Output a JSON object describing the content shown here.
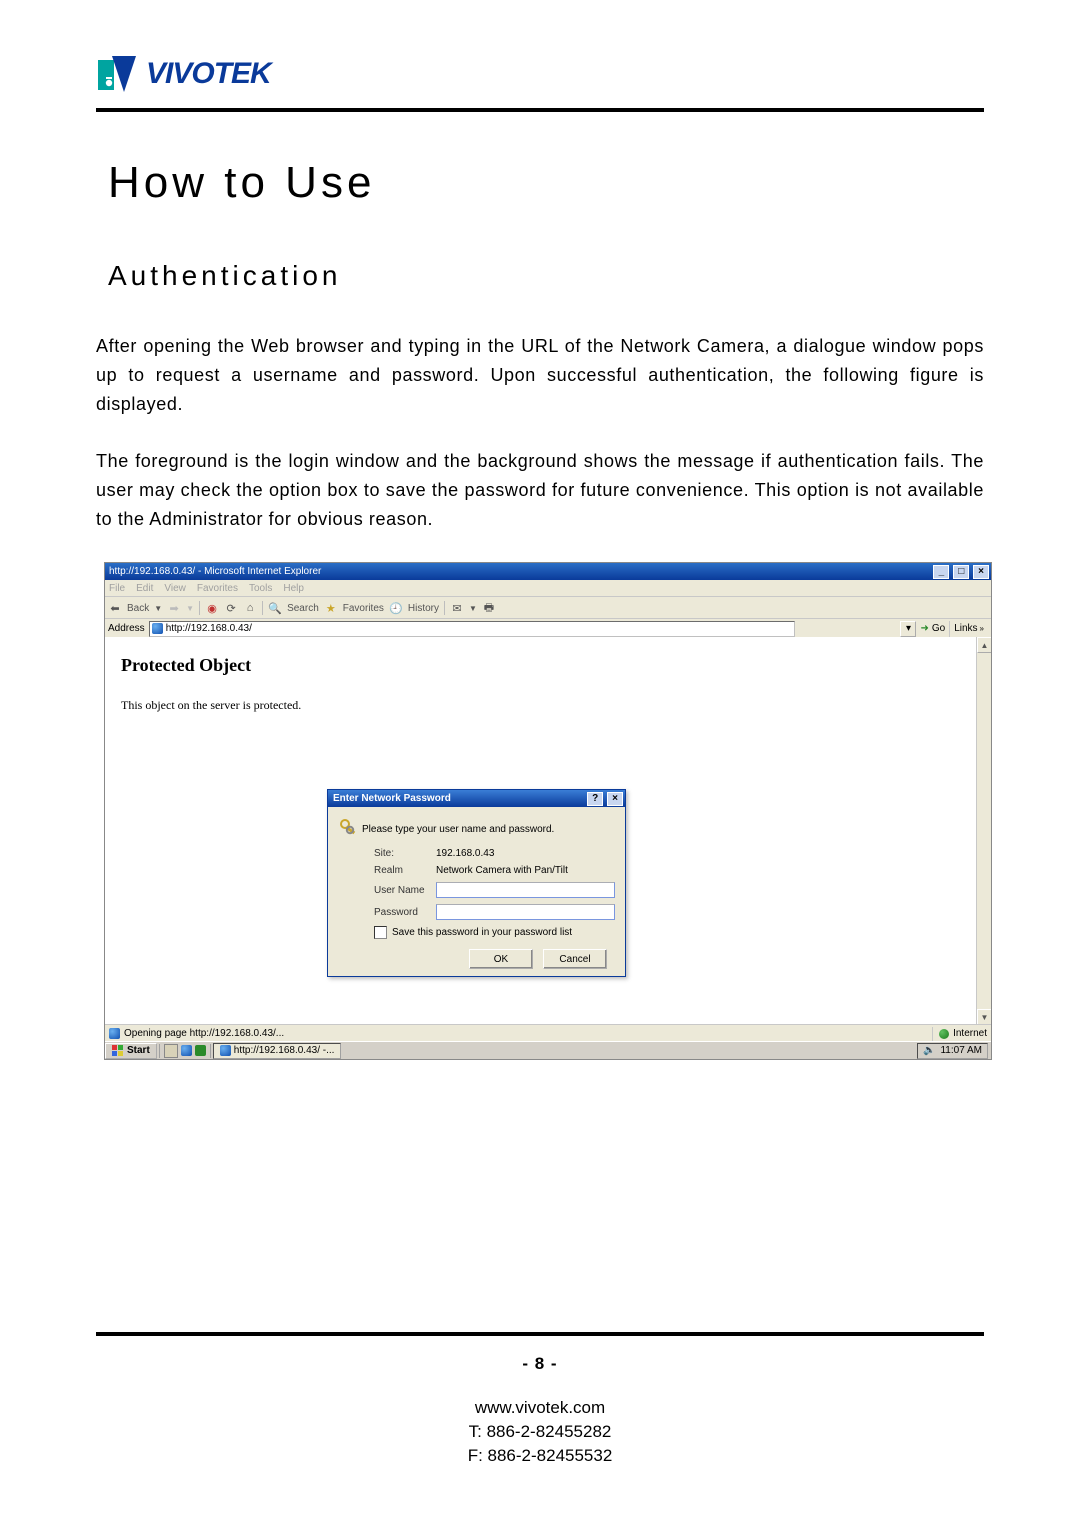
{
  "header": {
    "brand": "VIVOTEK"
  },
  "doc": {
    "title": "How to Use",
    "section": "Authentication",
    "para1": "After opening the Web browser and typing in the URL of the Network Camera, a dialogue window pops up to request a username and password. Upon successful authentication, the following figure is displayed.",
    "para2": "The foreground is the login window and the background shows the message if authentication fails. The user may check the option box to save the password for future convenience.   This option is not available to the Administrator for obvious reason."
  },
  "screenshot": {
    "browser_title": "http://192.168.0.43/ - Microsoft Internet Explorer",
    "menu": [
      "File",
      "Edit",
      "View",
      "Favorites",
      "Tools",
      "Help"
    ],
    "toolbar": {
      "back": "Back",
      "search": "Search",
      "favorites": "Favorites",
      "history": "History"
    },
    "address_label": "Address",
    "address_value": "http://192.168.0.43/",
    "go_label": "Go",
    "links_label": "Links",
    "page": {
      "heading": "Protected Object",
      "desc": "This object on the server is protected."
    },
    "dialog": {
      "title": "Enter Network Password",
      "prompt": "Please type your user name and password.",
      "site_label": "Site:",
      "site_value": "192.168.0.43",
      "realm_label": "Realm",
      "realm_value": "Network Camera with Pan/Tilt",
      "user_label": "User Name",
      "pass_label": "Password",
      "save_label": "Save this password in your password list",
      "ok": "OK",
      "cancel": "Cancel"
    },
    "statusbar": {
      "status": "Opening page http://192.168.0.43/...",
      "zone": "Internet"
    },
    "taskbar": {
      "start": "Start",
      "task1": "http://192.168.0.43/ -...",
      "time": "11:07 AM"
    }
  },
  "footer": {
    "page": "- 8 -",
    "url": "www.vivotek.com",
    "tel": "T: 886-2-82455282",
    "fax": "F: 886-2-82455532"
  }
}
